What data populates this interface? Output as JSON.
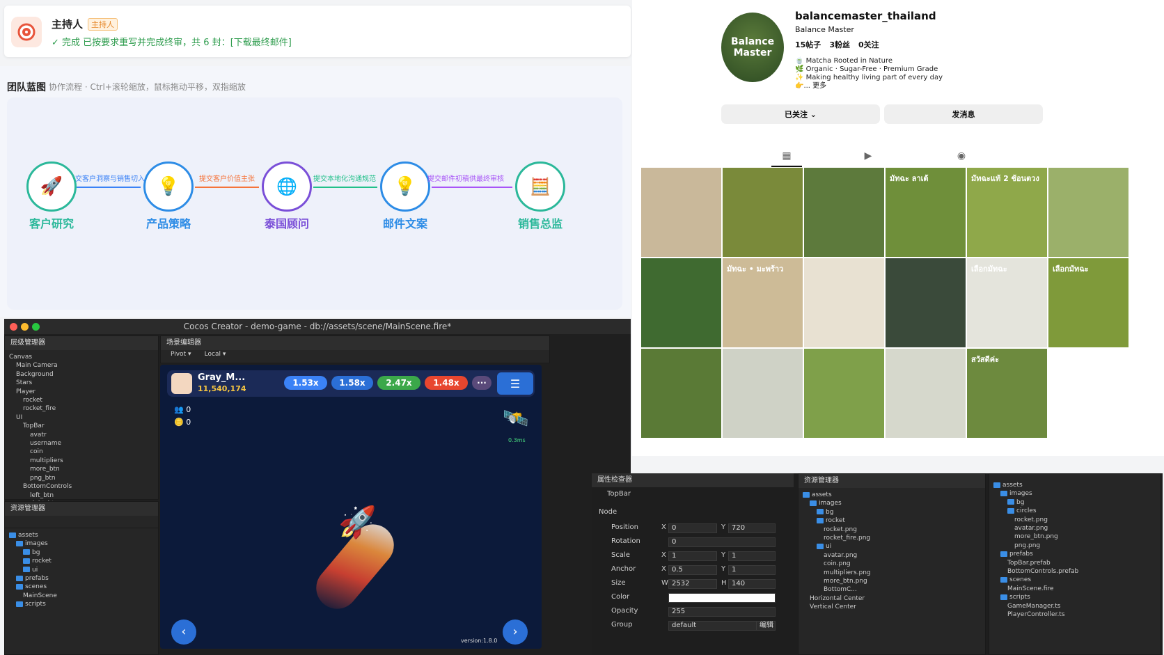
{
  "host": {
    "name": "主持人",
    "tag": "主持人",
    "message": "✓ 完成 已按要求重写并完成终审，共 6 封：[下载最终邮件]"
  },
  "blueprint": {
    "title": "团队蓝图",
    "subtitle": "协作流程 · Ctrl+滚轮缩放，鼠标拖动平移，双指缩放",
    "nodes": [
      {
        "label": "客户研究",
        "icon": "rocket-icon",
        "color": "#2bb89a"
      },
      {
        "label": "产品策略",
        "icon": "bulb-icon",
        "color": "#2d8ce6"
      },
      {
        "label": "泰国顾问",
        "icon": "globe-icon",
        "color": "#7a4fd8"
      },
      {
        "label": "邮件文案",
        "icon": "bulb-icon",
        "color": "#2d8ce6"
      },
      {
        "label": "销售总监",
        "icon": "abacus-icon",
        "color": "#2bb89a"
      }
    ],
    "edges": [
      {
        "label": "交客户洞察与销售切入",
        "color": "#3b82f6"
      },
      {
        "label": "提交客户价值主张",
        "color": "#f5743b"
      },
      {
        "label": "提交本地化沟通规范",
        "color": "#22c08a"
      },
      {
        "label": "提交邮件初稿供最终审核",
        "color": "#a855f7"
      }
    ]
  },
  "instagram": {
    "username": "balancemaster_thailand",
    "fullname": "Balance Master",
    "avatar_text": "Balance Master",
    "stats": [
      "15帖子",
      "3粉丝",
      "0关注"
    ],
    "bio": [
      "🍵 Matcha Rooted in Nature",
      "🌿 Organic · Sugar-Free · Premium Grade",
      "✨ Making healthy living part of every day",
      "👉... 更多"
    ],
    "follow_btn": "已关注 ⌄",
    "message_btn": "发消息",
    "tiles": [
      {
        "bg": "#c9b89a",
        "text": ""
      },
      {
        "bg": "#7a8a3a",
        "text": ""
      },
      {
        "bg": "#5d7a3c",
        "text": ""
      },
      {
        "bg": "#6f8f3a",
        "text": "มัทฉะ ลาเต้"
      },
      {
        "bg": "#8fa84a",
        "text": "มัทฉะแท้ 2 ช้อนตวง"
      },
      {
        "bg": "#9bb06a",
        "text": ""
      },
      {
        "bg": "#3f6a30",
        "text": ""
      },
      {
        "bg": "#cdbb97",
        "text": "มัทฉะ • มะพร้าว"
      },
      {
        "bg": "#e8e1d2",
        "text": ""
      },
      {
        "bg": "#3a4a3a",
        "text": ""
      },
      {
        "bg": "#e4e4dc",
        "text": "เลือกมัทฉะ"
      },
      {
        "bg": "#7f9a3a",
        "text": "เลือกมัทฉะ"
      },
      {
        "bg": "#5a7a36",
        "text": ""
      },
      {
        "bg": "#cfd2c6",
        "text": ""
      },
      {
        "bg": "#7fa04a",
        "text": ""
      },
      {
        "bg": "#d6d8cc",
        "text": ""
      },
      {
        "bg": "#6d8a3e",
        "text": "สวัสดีค่ะ"
      }
    ]
  },
  "cocos": {
    "title": "Cocos Creator - demo-game - db://assets/scene/MainScene.fire*",
    "hierarchy_title": "层级管理器",
    "hierarchy": [
      "Canvas",
      "Main Camera",
      "Background",
      "Stars",
      "Player",
      "rocket",
      "rocket_fire",
      "UI",
      "TopBar",
      "avatr",
      "username",
      "coin",
      "multipliers",
      "more_btn",
      "png_btn",
      "BottomControls",
      "left_btn",
      "right_btn"
    ],
    "assets_title": "资源管理器",
    "assets": [
      "assets",
      "images",
      "bg",
      "rocket",
      "ui",
      "prefabs",
      "scenes",
      "MainScene",
      "scripts"
    ],
    "scene_title": "场景编辑器",
    "toolbar": [
      "Pivot ▾",
      "Local ▾"
    ],
    "game": {
      "player": "Gray_M...",
      "coins": "11,540,174",
      "multipliers": [
        "1.53x",
        "1.58x",
        "2.47x",
        "1.48x"
      ],
      "players_count": "0",
      "coin_count": "0",
      "gems": "0.3ms",
      "version": "version:1.8.0"
    },
    "inspector_title": "属性检查器",
    "node_name": "TopBar",
    "section": "Node",
    "props": [
      {
        "label": "Position",
        "a": "X",
        "av": "0",
        "b": "Y",
        "bv": "720"
      },
      {
        "label": "Rotation",
        "a": "",
        "av": "0",
        "b": "",
        "bv": ""
      },
      {
        "label": "Scale",
        "a": "X",
        "av": "1",
        "b": "Y",
        "bv": "1"
      },
      {
        "label": "Anchor",
        "a": "X",
        "av": "0.5",
        "b": "Y",
        "bv": "1"
      },
      {
        "label": "Size",
        "a": "W",
        "av": "2532",
        "b": "H",
        "bv": "140"
      },
      {
        "label": "Color",
        "a": "",
        "av": "",
        "b": "",
        "bv": ""
      },
      {
        "label": "Opacity",
        "a": "",
        "av": "255",
        "b": "",
        "bv": ""
      },
      {
        "label": "Group",
        "a": "",
        "av": "default",
        "b": "",
        "bv": "编辑"
      }
    ],
    "files_title": "资源管理器",
    "files": [
      "assets",
      "images",
      "bg",
      "rocket",
      "rocket.png",
      "rocket_fire.png",
      "ui",
      "avatar.png",
      "coin.png",
      "multipliers.png",
      "more_btn.png",
      "BottomC..."
    ],
    "align": [
      "Horizontal Center",
      "Vertical Center"
    ],
    "files2": [
      "assets",
      "images",
      "bg",
      "circles",
      "rocket.png",
      "avatar.png",
      "more_btn.png",
      "png.png",
      "prefabs",
      "TopBar.prefab",
      "BottomControls.prefab",
      "scenes",
      "MainScene.fire",
      "scripts",
      "GameManager.ts",
      "PlayerController.ts"
    ]
  }
}
